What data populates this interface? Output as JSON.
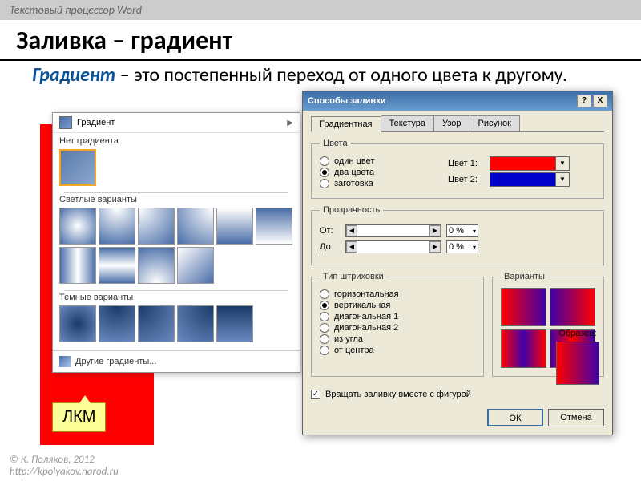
{
  "slide": {
    "header": "Текстовый процессор Word",
    "title": "Заливка – градиент",
    "keyword": "Градиент",
    "definition": " – это постепенный переход от одного цвета к другому."
  },
  "gallery": {
    "head": "Градиент",
    "no_gradient": "Нет градиента",
    "light": "Светлые варианты",
    "dark": "Темные варианты",
    "more": "Другие градиенты..."
  },
  "dialog": {
    "title": "Способы заливки",
    "close_help": "?",
    "close_x": "X",
    "tabs": {
      "gradient": "Градиентная",
      "texture": "Текстура",
      "pattern": "Узор",
      "picture": "Рисунок"
    },
    "colors_group": "Цвета",
    "radios": {
      "one": "один цвет",
      "two": "два цвета",
      "preset": "заготовка"
    },
    "color1_label": "Цвет 1:",
    "color2_label": "Цвет 2:",
    "transparency_group": "Прозрачность",
    "from_label": "От:",
    "to_label": "До:",
    "from_val": "0 %",
    "to_val": "0 %",
    "shading_group": "Тип штриховки",
    "shading": {
      "horizontal": "горизонтальная",
      "vertical": "вертикальная",
      "diag1": "диагональная 1",
      "diag2": "диагональная 2",
      "corner": "из угла",
      "center": "от центра"
    },
    "variants_group": "Варианты",
    "sample_label": "Образец:",
    "rotate_chk": "✓",
    "rotate_label": "Вращать заливку вместе с фигурой",
    "ok": "ОК",
    "cancel": "Отмена"
  },
  "callout": "ЛКМ",
  "footer": {
    "line1": "© К. Поляков, 2012",
    "line2": "http://kpolyakov.narod.ru"
  }
}
